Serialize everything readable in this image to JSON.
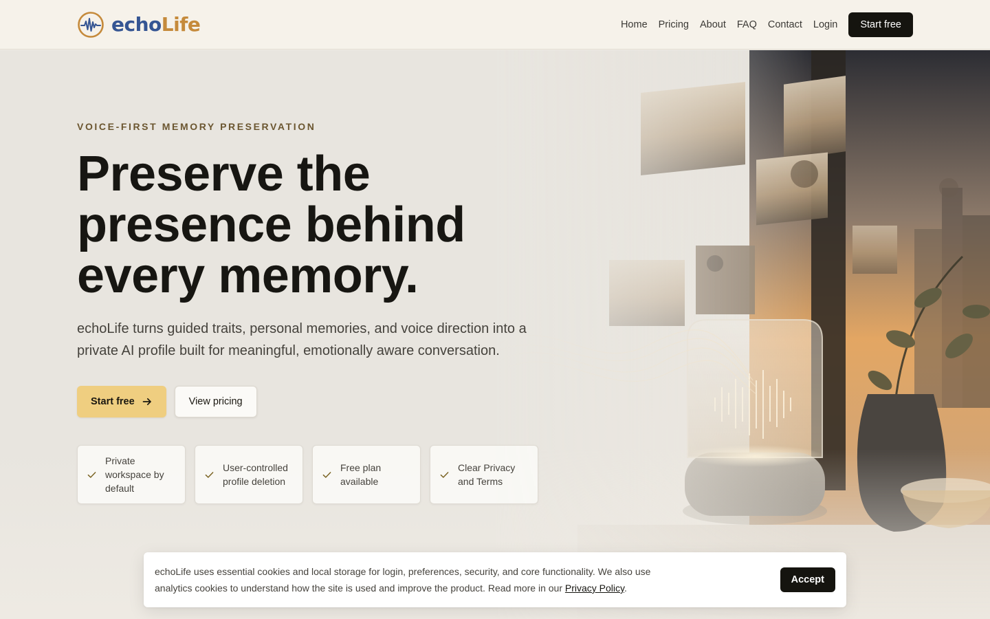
{
  "header": {
    "logo": {
      "echo": "echo",
      "life": "Life"
    },
    "nav": [
      "Home",
      "Pricing",
      "About",
      "FAQ",
      "Contact",
      "Login"
    ],
    "cta": "Start free"
  },
  "hero": {
    "eyebrow": "VOICE-FIRST MEMORY PRESERVATION",
    "headline": "Preserve the presence behind every memory.",
    "subhead": "echoLife turns guided traits, personal memories, and voice direction into a private AI profile built for meaningful, emotionally aware conversation.",
    "primary_button": "Start free",
    "secondary_button": "View pricing",
    "features": [
      "Private workspace by default",
      "User-controlled profile deletion",
      "Free plan available",
      "Clear Privacy and Terms"
    ]
  },
  "cookie": {
    "text": "echoLife uses essential cookies and local storage for login, preferences, security, and core functionality. We also use analytics cookies to understand how the site is used and improve the product. Read more in our",
    "link": "Privacy Policy",
    "suffix": ".",
    "accept": "Accept"
  },
  "colors": {
    "brand_blue": "#355593",
    "brand_gold": "#c58a3b",
    "accent_button": "#efce80",
    "dark": "#15140f"
  },
  "icons": [
    "logo-waveform-icon",
    "arrow-right-icon",
    "check-icon"
  ]
}
